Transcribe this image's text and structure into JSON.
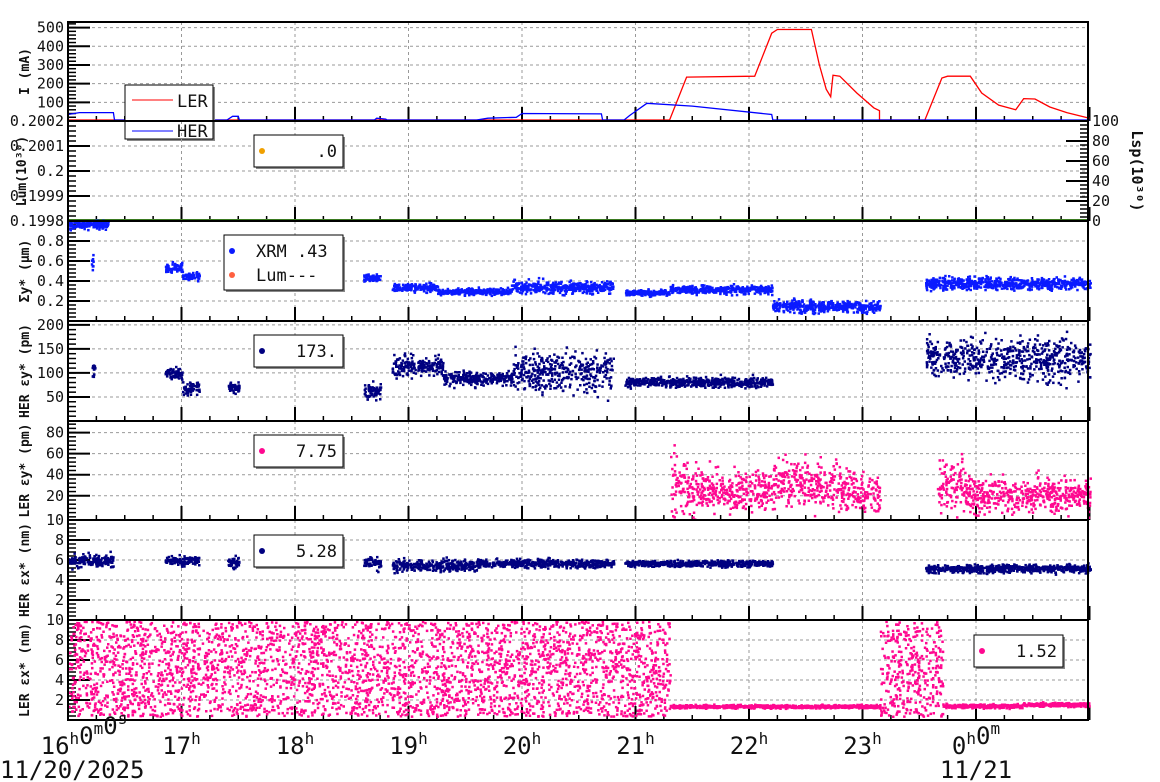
{
  "chart_data": {
    "type": "scatter",
    "x_axis": {
      "range_hours": [
        16,
        25
      ],
      "tick_labels": [
        "16h0m0s",
        "17h",
        "18h",
        "19h",
        "20h",
        "21h",
        "22h",
        "23h",
        "0h0m"
      ],
      "date_labels": [
        "11/20/2025",
        "11/21"
      ]
    },
    "panels": [
      {
        "id": "current",
        "ylabel": "I (mA)",
        "ylim": [
          0,
          530
        ],
        "ticks": [
          100,
          200,
          300,
          400,
          500
        ],
        "kind": "line",
        "legend": {
          "entries": [
            {
              "label": "LER",
              "color": "#ff0000"
            },
            {
              "label": "HER",
              "color": "#0000ff"
            }
          ]
        },
        "series": [
          {
            "name": "LER",
            "color": "#ff0000",
            "points": [
              [
                16,
                0
              ],
              [
                21.3,
                0
              ],
              [
                21.45,
                235
              ],
              [
                22.05,
                240
              ],
              [
                22.2,
                470
              ],
              [
                22.25,
                490
              ],
              [
                22.55,
                490
              ],
              [
                22.62,
                300
              ],
              [
                22.68,
                170
              ],
              [
                22.72,
                130
              ],
              [
                22.74,
                245
              ],
              [
                22.8,
                240
              ],
              [
                22.95,
                150
              ],
              [
                23.1,
                70
              ],
              [
                23.15,
                55
              ],
              [
                23.15,
                0
              ],
              [
                23.55,
                0
              ],
              [
                23.7,
                230
              ],
              [
                23.75,
                240
              ],
              [
                23.95,
                240
              ],
              [
                24.05,
                150
              ],
              [
                24.2,
                85
              ],
              [
                24.35,
                60
              ],
              [
                24.42,
                120
              ],
              [
                24.52,
                118
              ],
              [
                24.65,
                75
              ],
              [
                24.8,
                45
              ],
              [
                25,
                15
              ]
            ]
          },
          {
            "name": "HER",
            "color": "#0000ff",
            "points": [
              [
                16,
                35
              ],
              [
                16.1,
                45
              ],
              [
                16.4,
                45
              ],
              [
                16.41,
                0
              ],
              [
                16.85,
                0
              ],
              [
                16.9,
                45
              ],
              [
                17.0,
                45
              ],
              [
                17.1,
                40
              ],
              [
                17.11,
                0
              ],
              [
                17.4,
                0
              ],
              [
                17.45,
                25
              ],
              [
                17.5,
                25
              ],
              [
                17.51,
                0
              ],
              [
                18.7,
                0
              ],
              [
                18.72,
                15
              ],
              [
                18.8,
                10
              ],
              [
                18.81,
                0
              ],
              [
                19.6,
                0
              ],
              [
                19.7,
                15
              ],
              [
                19.95,
                20
              ],
              [
                20.0,
                40
              ],
              [
                20.7,
                38
              ],
              [
                20.71,
                0
              ],
              [
                20.9,
                0
              ],
              [
                20.95,
                30
              ],
              [
                21.1,
                95
              ],
              [
                21.5,
                80
              ],
              [
                22.2,
                35
              ],
              [
                22.21,
                0
              ],
              [
                25,
                0
              ]
            ]
          }
        ]
      },
      {
        "id": "luminosity",
        "ylabel": "Lum(10³⁰)",
        "ylim": [
          0.1998,
          0.2002
        ],
        "ticks": [
          0.1998,
          0.1999,
          0.2,
          0.2001,
          0.2002
        ],
        "tick_labels": [
          "0.1998",
          "0.1999",
          "0.2",
          "0.2001",
          "0.2002"
        ],
        "right_axis": {
          "label": "Lsp(10³⁰)",
          "ylim": [
            0,
            100
          ],
          "ticks": [
            0,
            20,
            40,
            60,
            80,
            100
          ]
        },
        "kind": "empty",
        "legend": {
          "entries": [
            {
              "label": ".0",
              "color": "#f0a000"
            }
          ]
        }
      },
      {
        "id": "sigma_y",
        "ylabel": "Σy* (μm)",
        "ylim": [
          0,
          1.0
        ],
        "ticks": [
          0.2,
          0.4,
          0.6,
          0.8
        ],
        "kind": "scatter",
        "color": "#0a1aff",
        "legend": {
          "entries": [
            {
              "label": "XRM  .43",
              "color": "#0a1aff"
            },
            {
              "label": "Lum---",
              "color": "#ff6040"
            }
          ]
        },
        "segments": [
          [
            16,
            16.35,
            0.96,
            0.02
          ],
          [
            16.2,
            16.22,
            0.57,
            0.04
          ],
          [
            16.85,
            17.0,
            0.53,
            0.02
          ],
          [
            17.0,
            17.15,
            0.44,
            0.02
          ],
          [
            17.4,
            17.5,
            0.45,
            0.02
          ],
          [
            18.6,
            18.75,
            0.42,
            0.02
          ],
          [
            18.85,
            19.25,
            0.33,
            0.02
          ],
          [
            19.25,
            19.9,
            0.29,
            0.015
          ],
          [
            19.9,
            20.8,
            0.33,
            0.03
          ],
          [
            20.9,
            21.3,
            0.28,
            0.015
          ],
          [
            21.3,
            22.2,
            0.31,
            0.02
          ],
          [
            22.2,
            23.15,
            0.14,
            0.03
          ],
          [
            23.55,
            25,
            0.37,
            0.03
          ]
        ]
      },
      {
        "id": "her_emit_y",
        "ylabel": "HER εy* (pm)",
        "ylim": [
          0,
          208
        ],
        "ticks": [
          50,
          100,
          150,
          200
        ],
        "kind": "scatter",
        "color": "#000080",
        "legend": {
          "entries": [
            {
              "label": "173.",
              "color": "#000080"
            }
          ]
        },
        "segments": [
          [
            16.2,
            16.23,
            105,
            10
          ],
          [
            16.85,
            17.0,
            97,
            6
          ],
          [
            17.0,
            17.15,
            67,
            7
          ],
          [
            17.4,
            17.5,
            68,
            6
          ],
          [
            18.6,
            18.75,
            62,
            8
          ],
          [
            18.85,
            19.3,
            112,
            10
          ],
          [
            19.3,
            19.9,
            88,
            7
          ],
          [
            19.9,
            20.8,
            100,
            20
          ],
          [
            20.9,
            22.2,
            80,
            5
          ],
          [
            23.55,
            23.9,
            130,
            20
          ],
          [
            23.9,
            25,
            128,
            22
          ]
        ]
      },
      {
        "id": "ler_emit_y",
        "ylabel": "LER εy* (pm)",
        "ylim": [
          -3,
          91
        ],
        "ticks": [
          20,
          40,
          60,
          80
        ],
        "kind": "scatter",
        "color": "#ff0890",
        "legend": {
          "entries": [
            {
              "label": "7.75",
              "color": "#ff0890"
            }
          ]
        },
        "segments": [
          [
            21.3,
            21.45,
            30,
            14
          ],
          [
            21.45,
            22.2,
            25,
            10
          ],
          [
            22.2,
            22.8,
            30,
            11
          ],
          [
            22.8,
            23.15,
            22,
            9
          ],
          [
            23.65,
            23.9,
            30,
            14
          ],
          [
            23.9,
            25,
            20,
            8
          ]
        ]
      },
      {
        "id": "her_emit_x",
        "ylabel": "HER εx* (nm)",
        "ylim": [
          0,
          10
        ],
        "ticks": [
          2,
          4,
          6,
          8,
          10
        ],
        "kind": "scatter",
        "color": "#000080",
        "legend": {
          "entries": [
            {
              "label": "5.28",
              "color": "#000080"
            }
          ]
        },
        "segments": [
          [
            16,
            16.4,
            5.9,
            0.3
          ],
          [
            16.85,
            17.15,
            5.9,
            0.2
          ],
          [
            17.4,
            17.5,
            5.7,
            0.3
          ],
          [
            18.6,
            18.75,
            5.7,
            0.3
          ],
          [
            18.85,
            19.6,
            5.4,
            0.3
          ],
          [
            19.6,
            20.8,
            5.6,
            0.2
          ],
          [
            20.9,
            22.2,
            5.6,
            0.15
          ],
          [
            23.55,
            25,
            5.1,
            0.2
          ]
        ]
      },
      {
        "id": "ler_emit_x",
        "ylabel": "LER εx* (nm)",
        "ylim": [
          0,
          10
        ],
        "ticks": [
          2,
          4,
          6,
          8,
          10
        ],
        "kind": "scatter",
        "color": "#ff0890",
        "legend": {
          "entries": [
            {
              "label": "1.52",
              "color": "#ff0890"
            }
          ]
        },
        "segments": [
          [
            16,
            21.3,
            4.8,
            2.6
          ],
          [
            21.3,
            23.15,
            1.3,
            0.08
          ],
          [
            23.15,
            23.7,
            5,
            2.4
          ],
          [
            23.7,
            24.4,
            1.35,
            0.1
          ],
          [
            24.4,
            25,
            1.5,
            0.1
          ]
        ]
      }
    ]
  }
}
